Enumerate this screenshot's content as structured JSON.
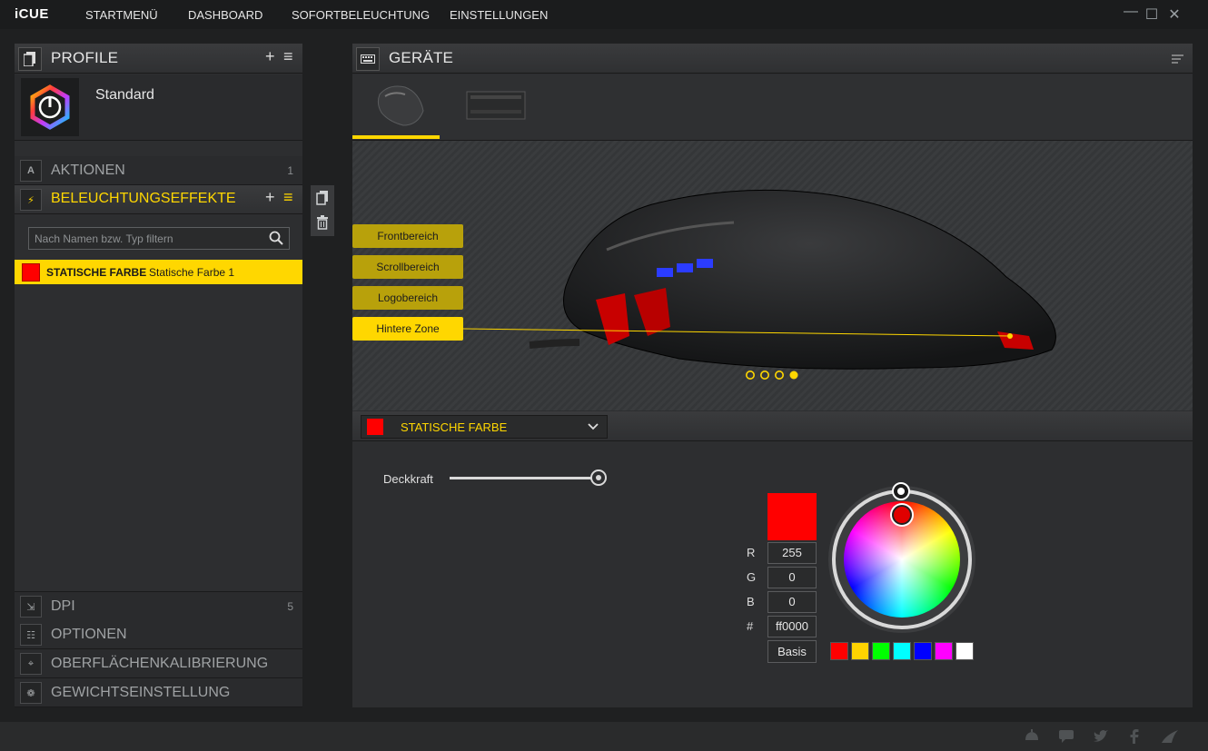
{
  "app": {
    "brand": "iCUE"
  },
  "nav": [
    "STARTMENÜ",
    "DASHBOARD",
    "SOFORTBELEUCHTUNG",
    "EINSTELLUNGEN"
  ],
  "window": {
    "minimize": "—",
    "maximize": "☐",
    "close": "✕"
  },
  "profile": {
    "title": "PROFILE",
    "add": "+",
    "menu": "≡",
    "name": "Standard"
  },
  "sections": {
    "actions": {
      "label": "AKTIONEN",
      "count": "1"
    },
    "lighting": {
      "label": "BELEUCHTUNGSEFFEKTE",
      "add": "+",
      "menu": "≡"
    },
    "dpi": {
      "label": "DPI",
      "count": "5"
    },
    "options": {
      "label": "OPTIONEN"
    },
    "calibration": {
      "label": "OBERFLÄCHENKALIBRIERUNG"
    },
    "weight": {
      "label": "GEWICHTSEINSTELLUNG"
    }
  },
  "filter": {
    "placeholder": "Nach Namen bzw. Typ filtern"
  },
  "effect_item": {
    "type": "STATISCHE FARBE",
    "name": "Statische Farbe 1",
    "color": "#ff0000"
  },
  "devices": {
    "title": "GERÄTE"
  },
  "zones": [
    "Frontbereich",
    "Scrollbereich",
    "Logobereich",
    "Hintere Zone"
  ],
  "selected_zone": "Hintere Zone",
  "page_dots": {
    "count": 4,
    "active": 4
  },
  "effect_editor": {
    "type_label": "STATISCHE FARBE",
    "opacity_label": "Deckkraft",
    "opacity": 1.0
  },
  "color": {
    "r_label": "R",
    "g_label": "G",
    "b_label": "B",
    "hex_label": "#",
    "r": "255",
    "g": "0",
    "b": "0",
    "hex": "ff0000",
    "basis": "Basis",
    "preview": "#ff0000"
  },
  "swatches": [
    "#ff0000",
    "#ffd400",
    "#00ff00",
    "#00ffff",
    "#0000ff",
    "#ff00ff",
    "#ffffff"
  ],
  "accent": "#ffd700"
}
